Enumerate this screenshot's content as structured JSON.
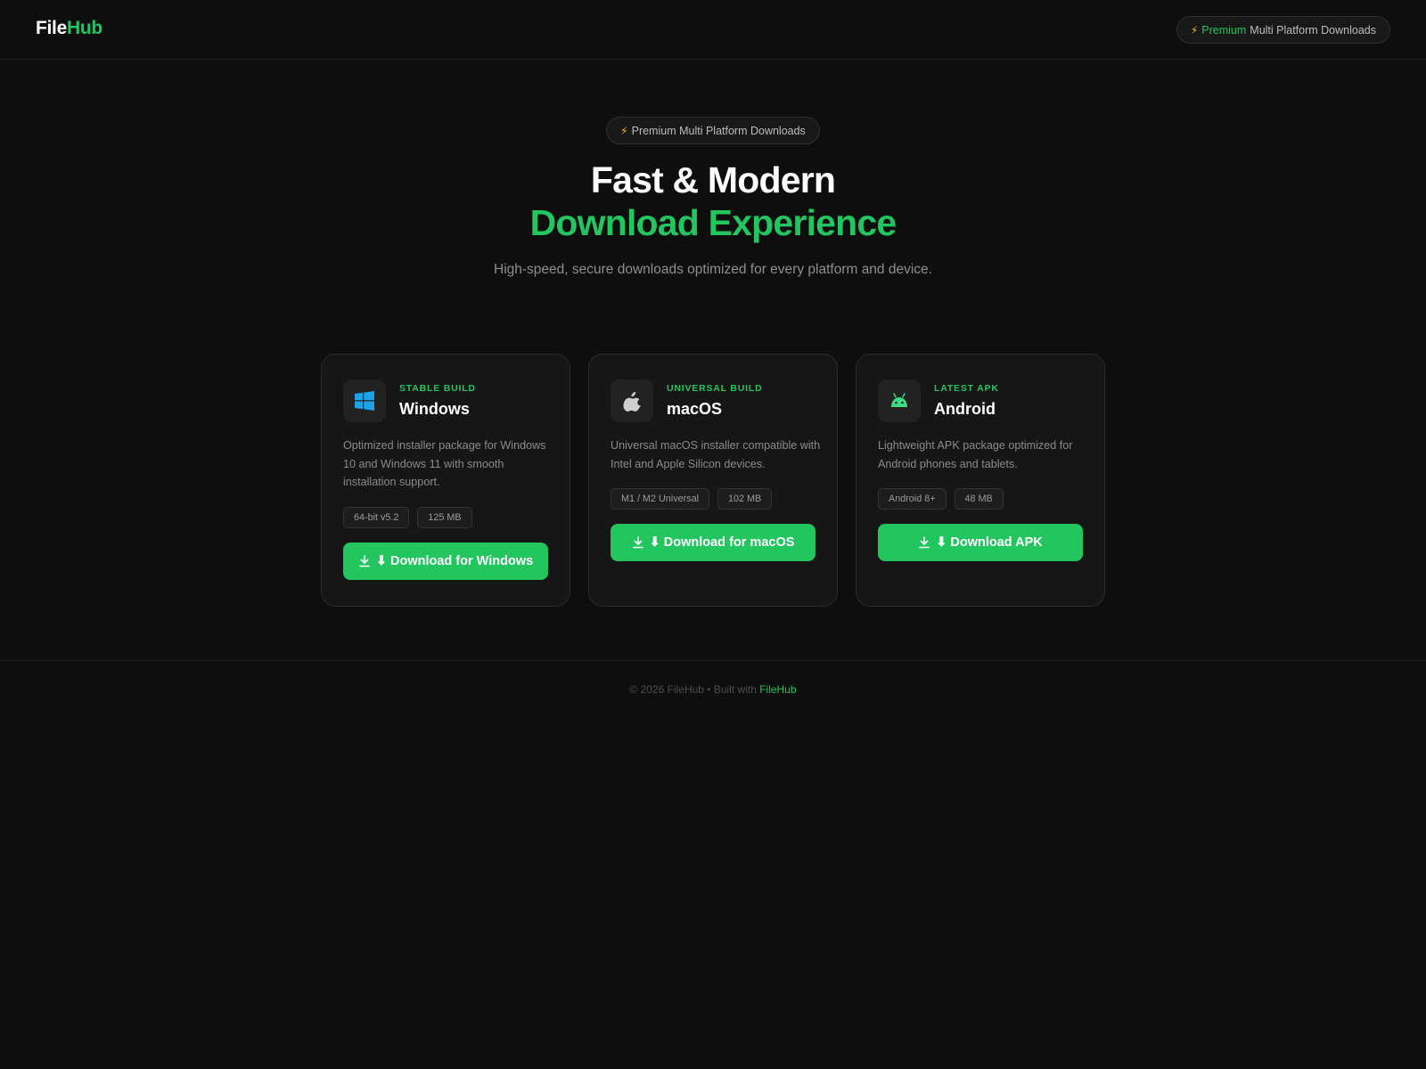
{
  "header": {
    "logo_part1": "File",
    "logo_part2": "Hub",
    "pill_bolt": "⚡",
    "pill_highlight": "Premium",
    "pill_rest": "Multi Platform Downloads"
  },
  "hero": {
    "pill_bolt": "⚡",
    "pill_text": "Premium Multi Platform Downloads",
    "title_line1": "Fast & Modern",
    "title_line2": "Download Experience",
    "subtitle": "High-speed, secure downloads optimized for every platform and device."
  },
  "cards": [
    {
      "icon": "windows-icon",
      "badge": "STABLE BUILD",
      "name": "Windows",
      "description": "Optimized installer package for Windows 10 and Windows 11 with smooth installation support.",
      "tags": [
        "64-bit v5.2",
        "125 MB"
      ],
      "button_label": "⬇ Download for Windows"
    },
    {
      "icon": "apple-icon",
      "badge": "UNIVERSAL BUILD",
      "name": "macOS",
      "description": "Universal macOS installer compatible with Intel and Apple Silicon devices.",
      "tags": [
        "M1 / M2 Universal",
        "102 MB"
      ],
      "button_label": "⬇ Download for macOS"
    },
    {
      "icon": "android-icon",
      "badge": "LATEST APK",
      "name": "Android",
      "description": "Lightweight APK package optimized for Android phones and tablets.",
      "tags": [
        "Android 8+",
        "48 MB"
      ],
      "button_label": "⬇ Download APK"
    }
  ],
  "footer": {
    "text": "© 2026 FileHub • Built with",
    "brand": "FileHub"
  },
  "colors": {
    "accent": "#22c55e",
    "background": "#0e0e0e",
    "card": "#161616",
    "windows_blue": "#1aa3e8",
    "android_green": "#3ddc84",
    "bolt": "#f5b82e"
  }
}
